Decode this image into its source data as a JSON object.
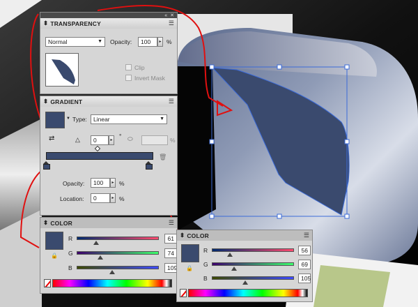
{
  "colors": {
    "swatch": "#3a4a6e",
    "annotation": "#e01010",
    "selection": "#3a6ad8"
  },
  "transparency": {
    "tab": "TRANSPARENCY",
    "blend_mode": "Normal",
    "opacity_label": "Opacity:",
    "opacity_value": "100",
    "opacity_unit": "%",
    "clip_label": "Clip",
    "invert_mask_label": "Invert Mask"
  },
  "gradient": {
    "tab": "GRADIENT",
    "type_label": "Type:",
    "type_value": "Linear",
    "angle_value": "0",
    "degree_symbol": "°",
    "aspect_unit": "%",
    "opacity_label": "Opacity:",
    "opacity_value": "100",
    "opacity_unit": "%",
    "location_label": "Location:",
    "location_value": "0",
    "location_unit": "%"
  },
  "color_panel_1": {
    "tab": "COLOR",
    "r_label": "R",
    "r_value": "61",
    "g_label": "G",
    "g_value": "74",
    "b_label": "B",
    "b_value": "109",
    "r_level": 0.24,
    "g_level": 0.29,
    "b_level": 0.43
  },
  "color_panel_2": {
    "tab": "COLOR",
    "r_label": "R",
    "r_value": "56",
    "g_label": "G",
    "g_value": "69",
    "b_label": "B",
    "b_value": "105",
    "r_level": 0.22,
    "g_level": 0.27,
    "b_level": 0.41
  },
  "icons": {
    "collapse": "«",
    "close": "✕",
    "menu": "☰",
    "tab_arrows": "⬍",
    "dropdown": "▼",
    "spin_right": "▸",
    "trash": "🗑",
    "lock": "🔒"
  }
}
